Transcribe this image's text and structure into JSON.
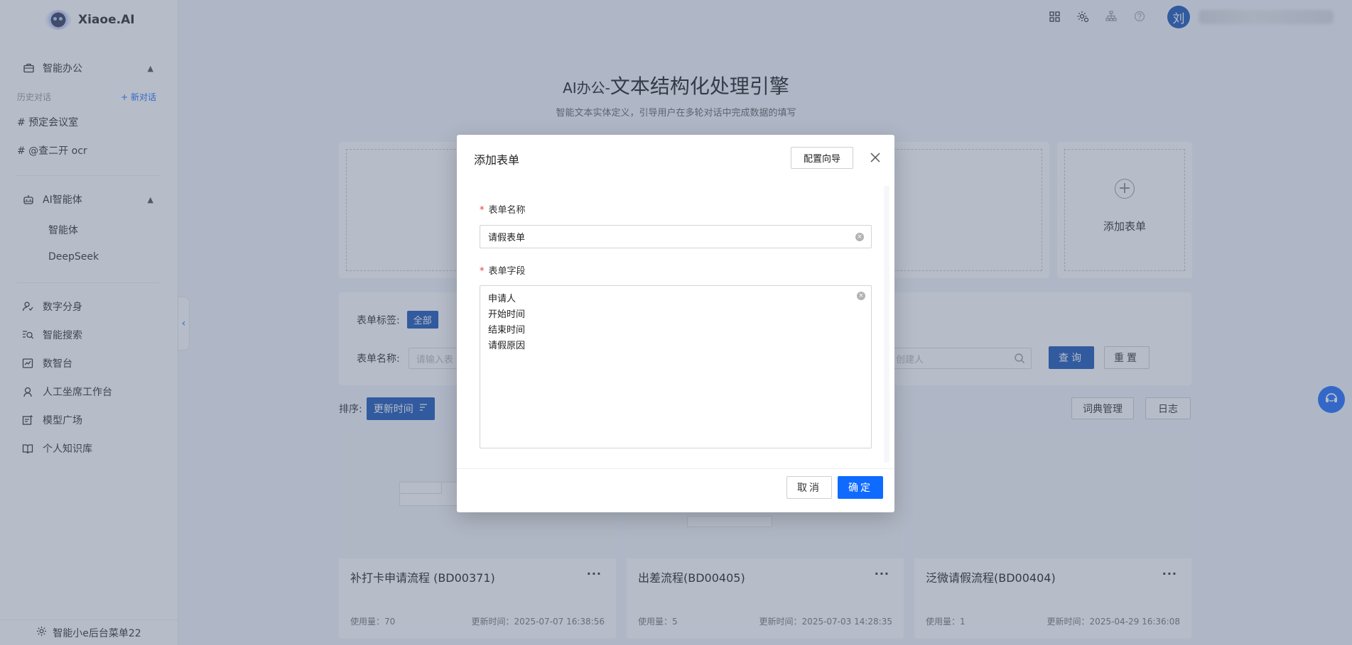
{
  "app": {
    "logo_text": "Xiaoe.AI"
  },
  "sidebar": {
    "office_group": "智能办公",
    "history_label": "历史对话",
    "new_chat": "+ 新对话",
    "chats": [
      "# 预定会议室",
      "# @查二开 ocr"
    ],
    "agent_group": "AI智能体",
    "agent_items": [
      "智能体",
      "DeepSeek"
    ],
    "menu": [
      "数字分身",
      "智能搜索",
      "数智台",
      "人工坐席工作台",
      "模型广场",
      "个人知识库"
    ],
    "footer": "智能小e后台菜单22"
  },
  "header": {
    "avatar_initial": "刘"
  },
  "page": {
    "title_prefix": "AI办公-",
    "title_main": "文本结构化处理引擎",
    "subtitle": "智能文本实体定义，引导用户在多轮对话中完成数据的填写",
    "add_form_card": "添加表单"
  },
  "filters": {
    "tag_label": "表单标签:",
    "tag_all": "全部",
    "name_label": "表单名称:",
    "name_placeholder": "请输入表",
    "creator_placeholder": "创建人",
    "query": "查询",
    "reset": "重置"
  },
  "sort": {
    "label": "排序:",
    "value": "更新时间",
    "dict_btn": "词典管理",
    "log_btn": "日志"
  },
  "cards": [
    {
      "title": "补打卡申请流程 (BD00371)",
      "usage": "使用量：70",
      "updated": "更新时间：2025-07-07 16:38:56"
    },
    {
      "title": "出差流程(BD00405)",
      "usage": "使用量：5",
      "updated": "更新时间：2025-07-03 14:28:35"
    },
    {
      "title": "泛微请假流程(BD00404)",
      "usage": "使用量：1",
      "updated": "更新时间：2025-04-29 16:36:08"
    }
  ],
  "modal": {
    "title": "添加表单",
    "guide_button": "配置向导",
    "name_label": "表单名称",
    "name_value": "请假表单",
    "fields_label": "表单字段",
    "fields": [
      "申请人",
      "开始时间",
      "结束时间",
      "请假原因"
    ],
    "cancel": "取消",
    "ok": "确定"
  },
  "colors": {
    "primary": "#1a56b8",
    "accent": "#0f6bff",
    "required": "#e23b3b"
  }
}
